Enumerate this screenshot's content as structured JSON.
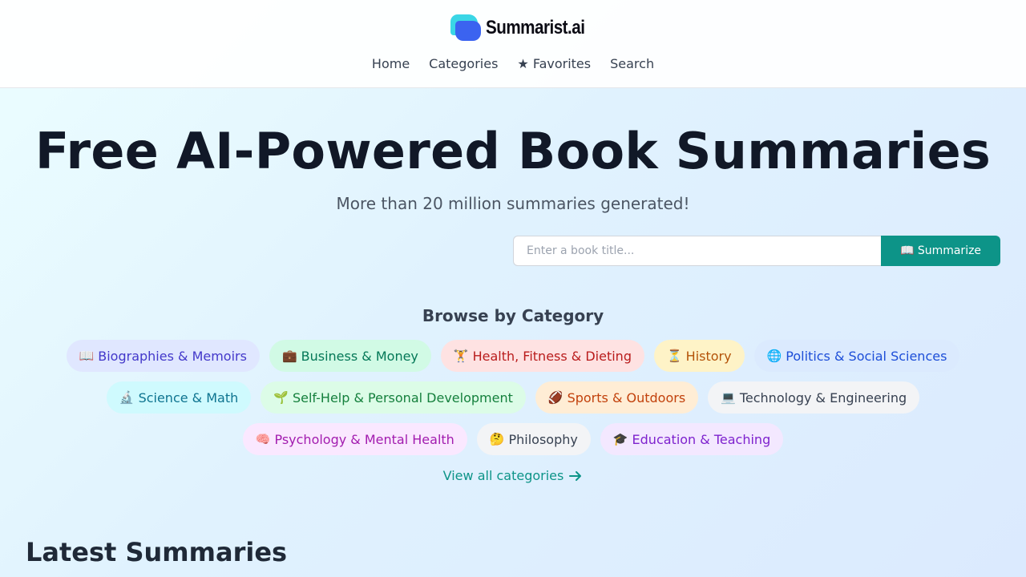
{
  "header": {
    "logo_text": "Summarist.ai",
    "nav": [
      {
        "label": "Home"
      },
      {
        "label": "Categories"
      },
      {
        "label": "★ Favorites"
      },
      {
        "label": "Search"
      }
    ]
  },
  "hero": {
    "title": "Free AI-Powered Book Summaries",
    "subtitle": "More than 20 million summaries generated!"
  },
  "search": {
    "placeholder": "Enter a book title...",
    "button_label": "📖 Summarize"
  },
  "browse": {
    "title": "Browse by Category",
    "rows": [
      [
        {
          "emoji": "📖",
          "label": "Biographies & Memoirs",
          "bg": "#e0e7ff",
          "fg": "#4338ca"
        },
        {
          "emoji": "💼",
          "label": "Business & Money",
          "bg": "#d1fae5",
          "fg": "#047857"
        },
        {
          "emoji": "🏋",
          "label": "Health, Fitness & Dieting",
          "bg": "#fee2e2",
          "fg": "#b91c1c"
        },
        {
          "emoji": "⏳",
          "label": "History",
          "bg": "#fef3c7",
          "fg": "#b45309"
        },
        {
          "emoji": "🌐",
          "label": "Politics & Social Sciences",
          "bg": "#dbeafe",
          "fg": "#1d4ed8"
        }
      ],
      [
        {
          "emoji": "🔬",
          "label": "Science & Math",
          "bg": "#cffafe",
          "fg": "#0e7490"
        },
        {
          "emoji": "🌱",
          "label": "Self-Help & Personal Development",
          "bg": "#dcfce7",
          "fg": "#15803d"
        },
        {
          "emoji": "🏈",
          "label": "Sports & Outdoors",
          "bg": "#ffedd5",
          "fg": "#c2410c"
        },
        {
          "emoji": "💻",
          "label": "Technology & Engineering",
          "bg": "#f3f4f6",
          "fg": "#374151"
        }
      ],
      [
        {
          "emoji": "🧠",
          "label": "Psychology & Mental Health",
          "bg": "#fae8ff",
          "fg": "#a21caf"
        },
        {
          "emoji": "🤔",
          "label": "Philosophy",
          "bg": "#f3f4f6",
          "fg": "#374151"
        },
        {
          "emoji": "🎓",
          "label": "Education & Teaching",
          "bg": "#f3e8ff",
          "fg": "#7e22ce"
        }
      ]
    ],
    "view_all_label": "View all categories"
  },
  "latest": {
    "title": "Latest Summaries"
  }
}
